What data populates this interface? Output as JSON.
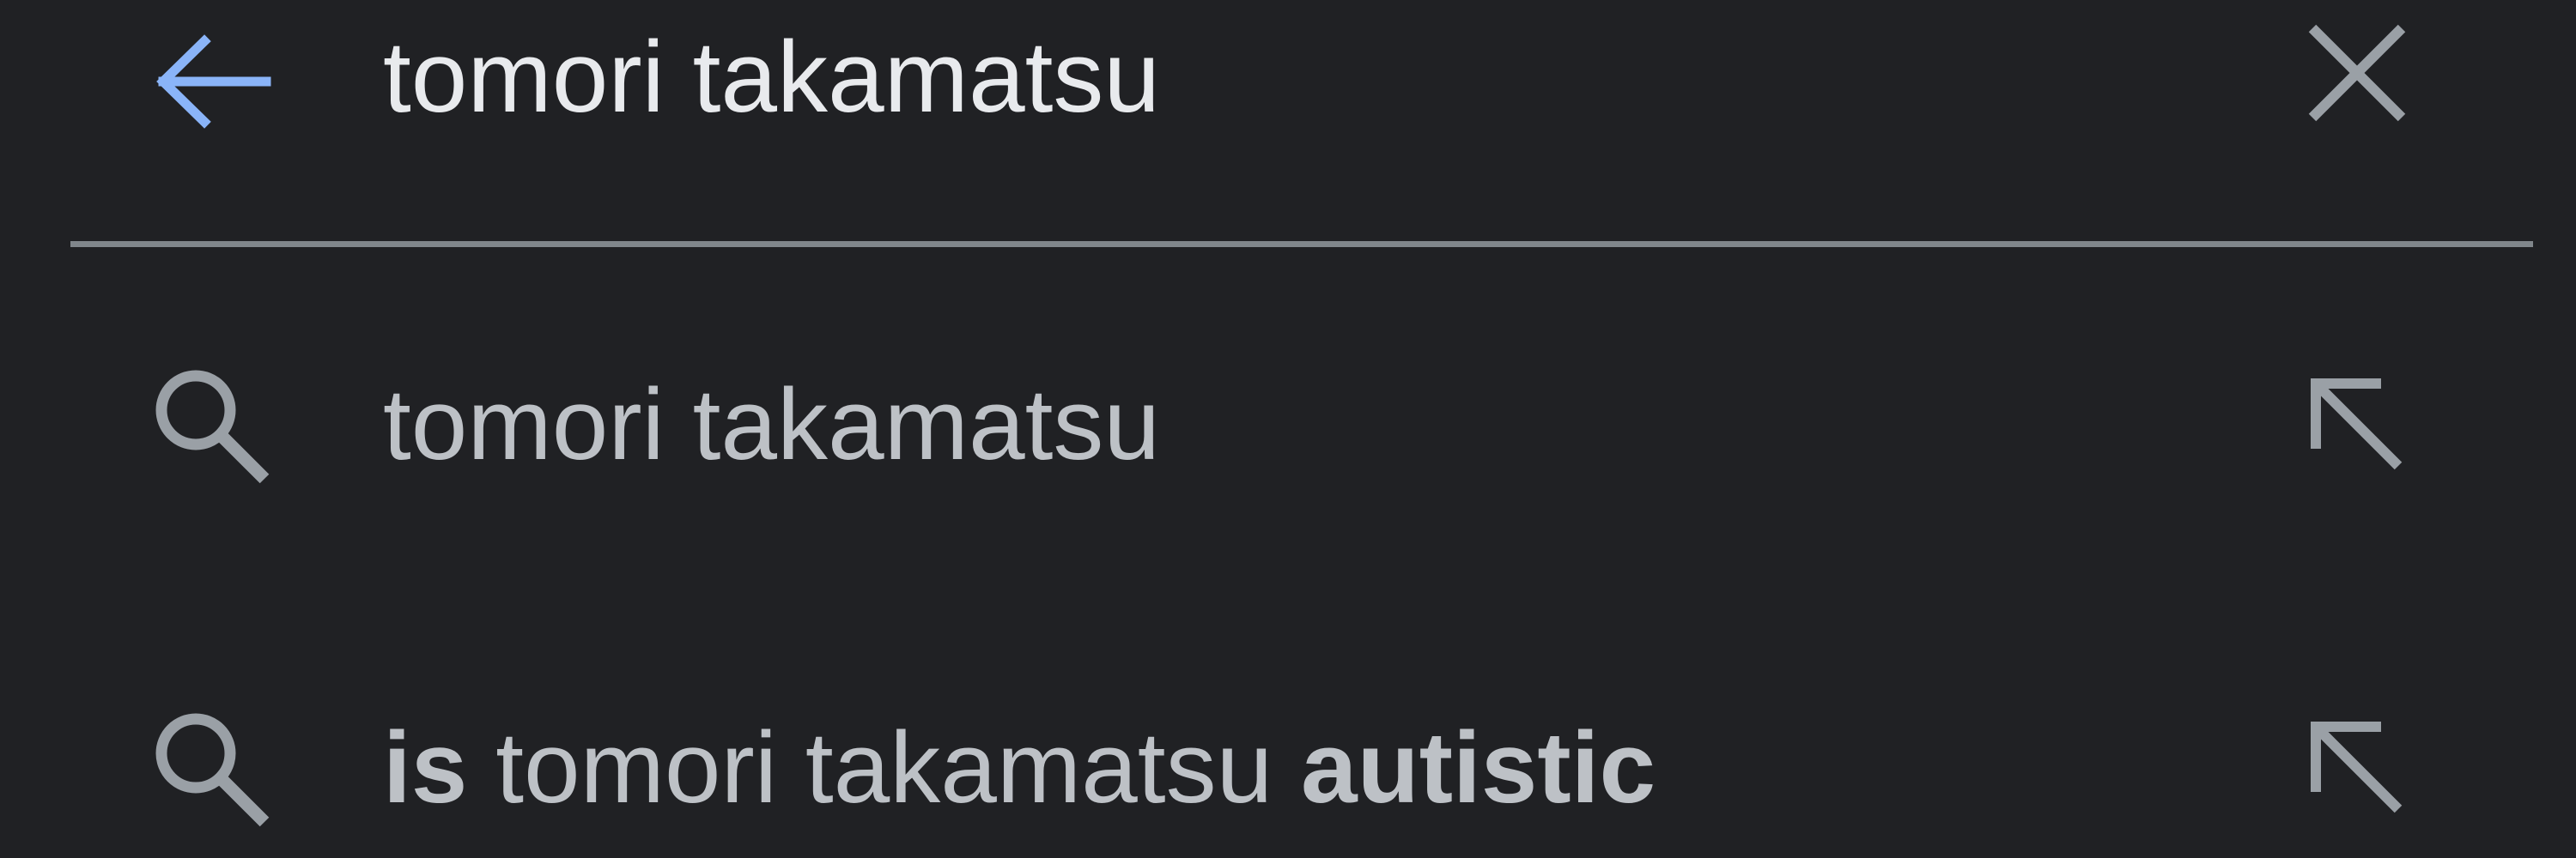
{
  "search": {
    "query": "tomori takamatsu"
  },
  "suggestions": [
    {
      "prefix_bold": "",
      "middle": "tomori takamatsu",
      "suffix_bold": "",
      "icon": "search-icon",
      "action_icon": "arrow-up-left-icon"
    },
    {
      "prefix_bold": "is",
      "middle": " tomori takamatsu ",
      "suffix_bold": "autistic",
      "icon": "search-icon",
      "action_icon": "arrow-up-left-icon"
    }
  ],
  "icons": {
    "back": "arrow-left-icon",
    "clear": "close-icon"
  },
  "colors": {
    "background": "#202124",
    "accent": "#8ab4f8",
    "query_text": "#e8eaed",
    "suggestion_text": "#bdc1c6",
    "icon": "#9aa0a6",
    "divider": "#80868b"
  }
}
